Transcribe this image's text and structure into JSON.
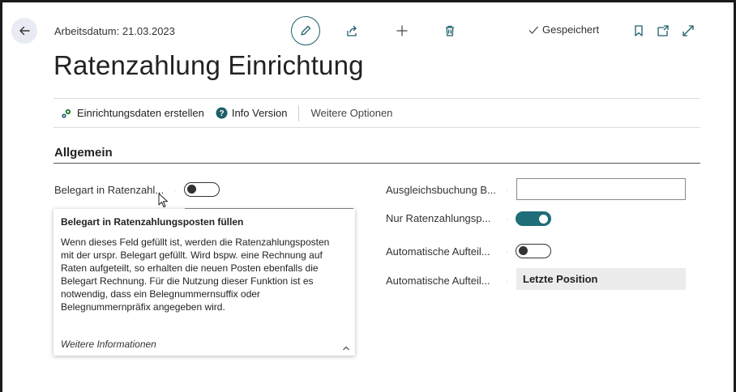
{
  "header": {
    "workdate_label": "Arbeitsdatum: 21.03.2023",
    "saved_label": "Gespeichert"
  },
  "page": {
    "title": "Ratenzahlung Einrichtung"
  },
  "actions": {
    "create_setup": "Einrichtungsdaten erstellen",
    "info_version": "Info Version",
    "more_options": "Weitere Optionen"
  },
  "section": {
    "title": "Allgemein"
  },
  "fields": {
    "belegart_label": "Belegart in Ratenzahl...",
    "belegart_value": false,
    "ausgleich_label": "Ausgleichsbuchung B...",
    "ausgleich_value": "",
    "nur_raten_label": "Nur Ratenzahlungsp...",
    "nur_raten_value": true,
    "auto_aufteil1_label": "Automatische Aufteil...",
    "auto_aufteil1_value": false,
    "auto_aufteil2_label": "Automatische Aufteil...",
    "auto_aufteil2_value": "Letzte Position"
  },
  "tooltip": {
    "title": "Belegart in Ratenzahlungsposten füllen",
    "body": "Wenn dieses Feld gefüllt ist, werden die Ratenzahlungsposten mit der urspr. Belegart gefüllt. Wird bspw. eine Rechnung auf Raten aufgeteilt, so erhalten die neuen Posten ebenfalls die Belegart Rechnung. Für die Nutzung dieser Funktion ist es notwendig, dass ein Belegnummernsuffix oder Belegnummernpräfix angegeben wird.",
    "more": "Weitere Informationen"
  },
  "icons": {
    "back": "back-arrow-icon",
    "edit": "pencil-icon",
    "share": "share-icon",
    "new": "plus-icon",
    "delete": "trash-icon",
    "saved": "checkmark-icon",
    "bookmark": "bookmark-icon",
    "open_new": "open-new-window-icon",
    "expand": "expand-icon",
    "setup": "gear-setup-icon",
    "info": "help-circle-icon",
    "chevron": "chevron-up-icon"
  },
  "colors": {
    "accent": "#1e6d78",
    "input_readonly_bg": "#ececec"
  }
}
